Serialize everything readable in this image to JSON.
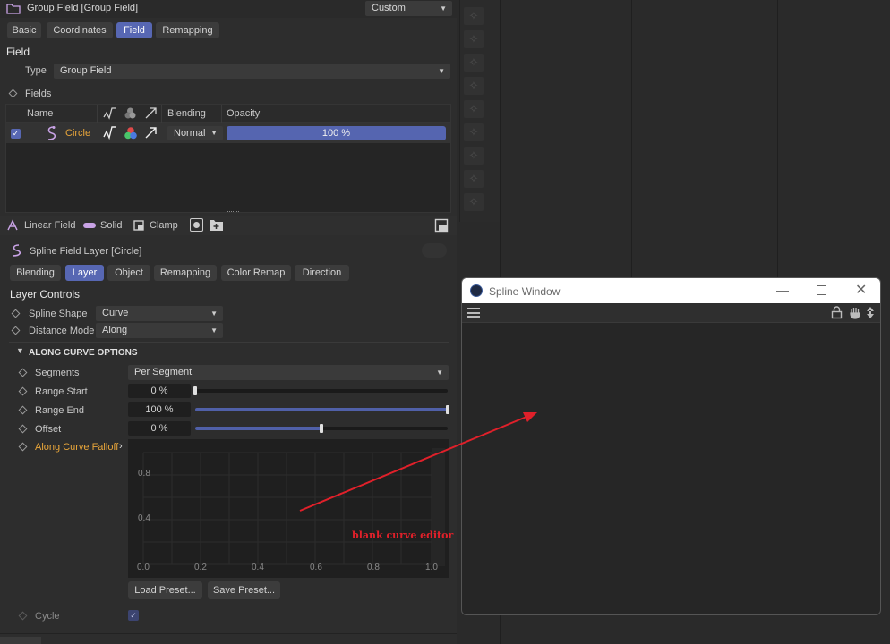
{
  "header": {
    "title": "Group Field [Group Field]",
    "mode": "Custom"
  },
  "tabs": [
    "Basic",
    "Coordinates",
    "Field",
    "Remapping"
  ],
  "section_field": "Field",
  "type": {
    "label": "Type",
    "value": "Group Field"
  },
  "fields": {
    "label": "Fields",
    "col_name": "Name",
    "col_blending": "Blending",
    "col_opacity": "Opacity",
    "row": {
      "name": "Circle",
      "blending": "Normal",
      "opacity": "100 %"
    }
  },
  "layer_toolbar": {
    "linear": "Linear Field",
    "solid": "Solid",
    "clamp": "Clamp"
  },
  "layer_title": "Spline Field Layer [Circle]",
  "layer_tabs": [
    "Blending",
    "Layer",
    "Object",
    "Remapping",
    "Color Remap",
    "Direction"
  ],
  "layer_controls": {
    "title": "Layer Controls",
    "spline_shape_label": "Spline Shape",
    "spline_shape": "Curve",
    "distance_mode_label": "Distance Mode",
    "distance_mode": "Along"
  },
  "along_curve": {
    "title": "ALONG CURVE OPTIONS",
    "segments_label": "Segments",
    "segments": "Per Segment",
    "range_start_label": "Range Start",
    "range_start": "0 %",
    "range_start_frac": 0,
    "range_end_label": "Range End",
    "range_end": "100 %",
    "range_end_frac": 1,
    "offset_label": "Offset",
    "offset": "0 %",
    "offset_frac": 0.5,
    "falloff_label": "Along Curve Falloff",
    "y_ticks": [
      "0.8",
      "0.4"
    ],
    "x_ticks": [
      "0.0",
      "0.2",
      "0.4",
      "0.6",
      "0.8",
      "1.0"
    ],
    "load_preset": "Load Preset...",
    "save_preset": "Save Preset...",
    "cycle_label": "Cycle"
  },
  "annotation": "blank curve editor",
  "spline_window": {
    "title": "Spline Window"
  },
  "colors": {
    "accent": "#5767b3",
    "annotation": "#e0202a",
    "highlight": "#e8a53a"
  }
}
